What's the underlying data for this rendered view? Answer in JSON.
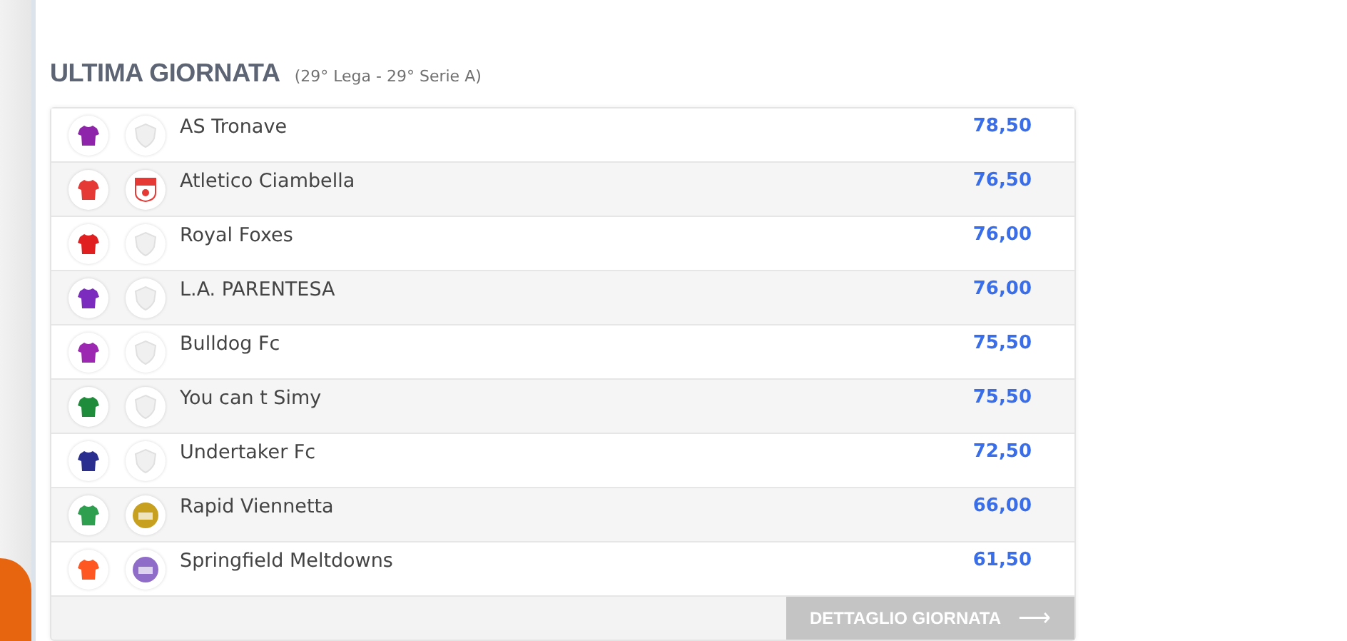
{
  "section": {
    "title": "ULTIMA GIORNATA",
    "subtitle": "(29° Lega - 29° Serie A)"
  },
  "rows": [
    {
      "team": "AS Tronave",
      "score": "78,50",
      "color": "#8e24aa",
      "crest": {
        "kind": "empty"
      }
    },
    {
      "team": "Atletico Ciambella",
      "score": "76,50",
      "color": "#e53935",
      "crest": {
        "kind": "shield",
        "color": "#e53935"
      }
    },
    {
      "team": "Royal Foxes",
      "score": "76,00",
      "color": "#e02020",
      "crest": {
        "kind": "empty"
      }
    },
    {
      "team": "L.A. PARENTESA",
      "score": "76,00",
      "color": "#7b2cbf",
      "crest": {
        "kind": "empty"
      }
    },
    {
      "team": "Bulldog Fc",
      "score": "75,50",
      "color": "#9c27b0",
      "crest": {
        "kind": "empty"
      }
    },
    {
      "team": "You can t Simy",
      "score": "75,50",
      "color": "#1e8c3a",
      "crest": {
        "kind": "empty"
      }
    },
    {
      "team": "Undertaker Fc",
      "score": "72,50",
      "color": "#2a2f8f",
      "crest": {
        "kind": "empty"
      }
    },
    {
      "team": "Rapid Viennetta",
      "score": "66,00",
      "color": "#2e9e4f",
      "crest": {
        "kind": "round",
        "color": "#c8a020"
      }
    },
    {
      "team": "Springfield Meltdowns",
      "score": "61,50",
      "color": "#ff5722",
      "crest": {
        "kind": "round",
        "color": "#8e6cc8"
      }
    }
  ],
  "button": {
    "label": "DETTAGLIO GIORNATA",
    "icon": "⟶"
  }
}
